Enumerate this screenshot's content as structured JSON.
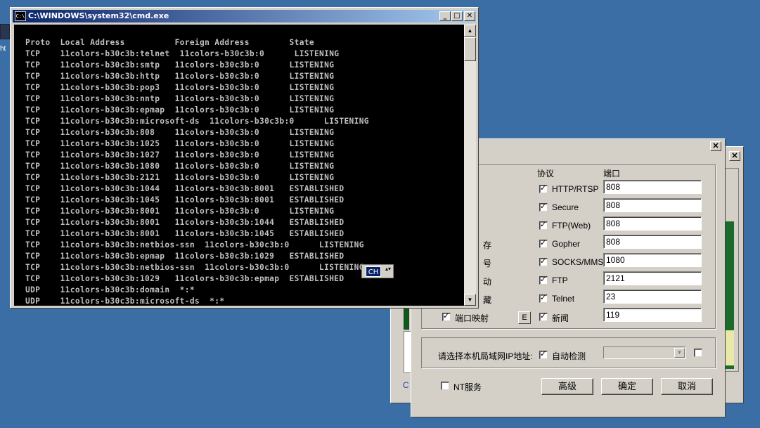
{
  "desktop": {
    "icon_text": "ht"
  },
  "cmd": {
    "title": "C:\\WINDOWS\\system32\\cmd.exe",
    "icon_text": "C:\\",
    "minimize": "_",
    "maximize": "□",
    "close": "✕",
    "output": "Proto  Local Address          Foreign Address        State\nTCP    11colors-b30c3b:telnet  11colors-b30c3b:0      LISTENING\nTCP    11colors-b30c3b:smtp   11colors-b30c3b:0      LISTENING\nTCP    11colors-b30c3b:http   11colors-b30c3b:0      LISTENING\nTCP    11colors-b30c3b:pop3   11colors-b30c3b:0      LISTENING\nTCP    11colors-b30c3b:nntp   11colors-b30c3b:0      LISTENING\nTCP    11colors-b30c3b:epmap  11colors-b30c3b:0      LISTENING\nTCP    11colors-b30c3b:microsoft-ds  11colors-b30c3b:0      LISTENING\nTCP    11colors-b30c3b:808    11colors-b30c3b:0      LISTENING\nTCP    11colors-b30c3b:1025   11colors-b30c3b:0      LISTENING\nTCP    11colors-b30c3b:1027   11colors-b30c3b:0      LISTENING\nTCP    11colors-b30c3b:1080   11colors-b30c3b:0      LISTENING\nTCP    11colors-b30c3b:2121   11colors-b30c3b:0      LISTENING\nTCP    11colors-b30c3b:1044   11colors-b30c3b:8001   ESTABLISHED\nTCP    11colors-b30c3b:1045   11colors-b30c3b:8001   ESTABLISHED\nTCP    11colors-b30c3b:8001   11colors-b30c3b:0      LISTENING\nTCP    11colors-b30c3b:8001   11colors-b30c3b:1044   ESTABLISHED\nTCP    11colors-b30c3b:8001   11colors-b30c3b:1045   ESTABLISHED\nTCP    11colors-b30c3b:netbios-ssn  11colors-b30c3b:0      LISTENING\nTCP    11colors-b30c3b:epmap  11colors-b30c3b:1029   ESTABLISHED\nTCP    11colors-b30c3b:netbios-ssn  11colors-b30c3b:0      LISTENING\nTCP    11colors-b30c3b:1029   11colors-b30c3b:epmap  ESTABLISHED\nUDP    11colors-b30c3b:domain  *:*\nUDP    11colors-b30c3b:microsoft-ds  *:*"
  },
  "ime": {
    "label": "CH",
    "dropdown": "▴▾"
  },
  "back_dialog": {
    "close": "✕",
    "c_text": "C"
  },
  "dialog": {
    "close": "✕",
    "header_protocol": "协议",
    "header_port": "端口",
    "left_partial": [
      "存",
      "号",
      "动",
      "藏"
    ],
    "protocols": [
      {
        "label": "HTTP/RTSP",
        "checked": true,
        "port": "808"
      },
      {
        "label": "Secure",
        "checked": true,
        "port": "808"
      },
      {
        "label": "FTP(Web)",
        "checked": true,
        "port": "808"
      },
      {
        "label": "Gopher",
        "checked": true,
        "port": "808"
      },
      {
        "label": "SOCKS/MMS",
        "checked": true,
        "port": "1080"
      },
      {
        "label": "FTP",
        "checked": true,
        "port": "2121"
      },
      {
        "label": "Telnet",
        "checked": true,
        "port": "23"
      },
      {
        "label": "新闻",
        "checked": true,
        "port": "119"
      }
    ],
    "port_mapping_label": "端口映射",
    "port_mapping_button": "E",
    "lan_ip_label": "请选择本机局域网IP地址:",
    "auto_detect_label": "自动检测",
    "combo_arrow": "▼",
    "nt_service_label": "NT服务",
    "advanced_button": "高级",
    "ok_button": "确定",
    "cancel_button": "取消"
  }
}
